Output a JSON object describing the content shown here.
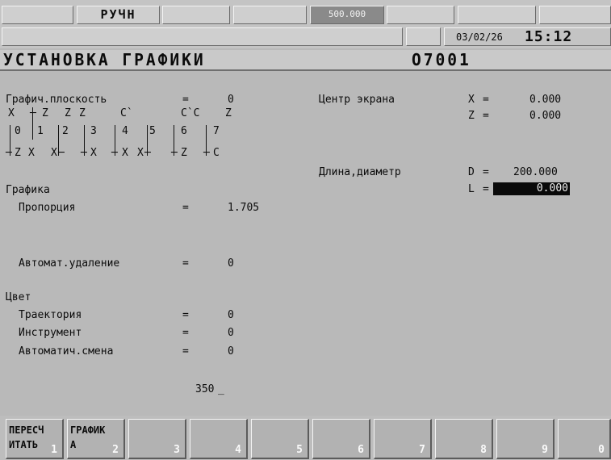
{
  "status": {
    "mode": "РУЧН",
    "feed_value": "500.000",
    "date": "03/02/26",
    "time": "15:12"
  },
  "screen": {
    "title": "УСТАНОВКА ГРАФИКИ",
    "program": "O7001"
  },
  "left": {
    "plane_label": "Графич.плоскость",
    "plane_eq": "=",
    "plane_value": "0",
    "schema": {
      "top_row": [
        "X",
        "Z",
        "Z",
        "Z",
        "C`",
        "C`C",
        "Z"
      ],
      "numbers": [
        "0",
        "1",
        "2",
        "3",
        "4",
        "5",
        "6",
        "7"
      ],
      "bottom_row": [
        "Z",
        "X",
        "X",
        "X",
        "X",
        "X",
        "Z",
        "C"
      ]
    },
    "graphics_header": "Графика",
    "proportion_label": "Пропорция",
    "proportion_eq": "=",
    "proportion_value": "1.705",
    "auto_delete_label": "Автомат.удаление",
    "auto_delete_eq": "=",
    "auto_delete_value": "0",
    "color_header": "Цвет",
    "trajectory_label": "Траектория",
    "trajectory_eq": "=",
    "trajectory_value": "0",
    "tool_label": "Инструмент",
    "tool_eq": "=",
    "tool_value": "0",
    "auto_change_label": "Автоматич.смена",
    "auto_change_eq": "=",
    "auto_change_value": "0"
  },
  "right": {
    "center_label": "Центр экрана",
    "x_label": "X",
    "x_eq": "=",
    "x_value": "0.000",
    "z_label": "Z",
    "z_eq": "=",
    "z_value": "0.000",
    "length_label": "Длина,диаметр",
    "d_label": "D",
    "d_eq": "=",
    "d_value": "200.000",
    "l_label": "L",
    "l_eq": "=",
    "l_value": "0.000"
  },
  "input": {
    "buffer": "350",
    "cursor": "_"
  },
  "softkeys": [
    {
      "line1": "ПЕРЕСЧ",
      "line2": "ИТАТЬ",
      "num": "1"
    },
    {
      "line1": "ГРАФИК",
      "line2": "А",
      "num": "2"
    },
    {
      "line1": "",
      "line2": "",
      "num": "3"
    },
    {
      "line1": "",
      "line2": "",
      "num": "4"
    },
    {
      "line1": "",
      "line2": "",
      "num": "5"
    },
    {
      "line1": "",
      "line2": "",
      "num": "6"
    },
    {
      "line1": "",
      "line2": "",
      "num": "7"
    },
    {
      "line1": "",
      "line2": "",
      "num": "8"
    },
    {
      "line1": "",
      "line2": "",
      "num": "9"
    },
    {
      "line1": "",
      "line2": "",
      "num": "0"
    }
  ],
  "colors": {
    "background": "#b9b9b9",
    "highlight": "#0a0a0a",
    "highlight_text": "#f0f0f0"
  }
}
